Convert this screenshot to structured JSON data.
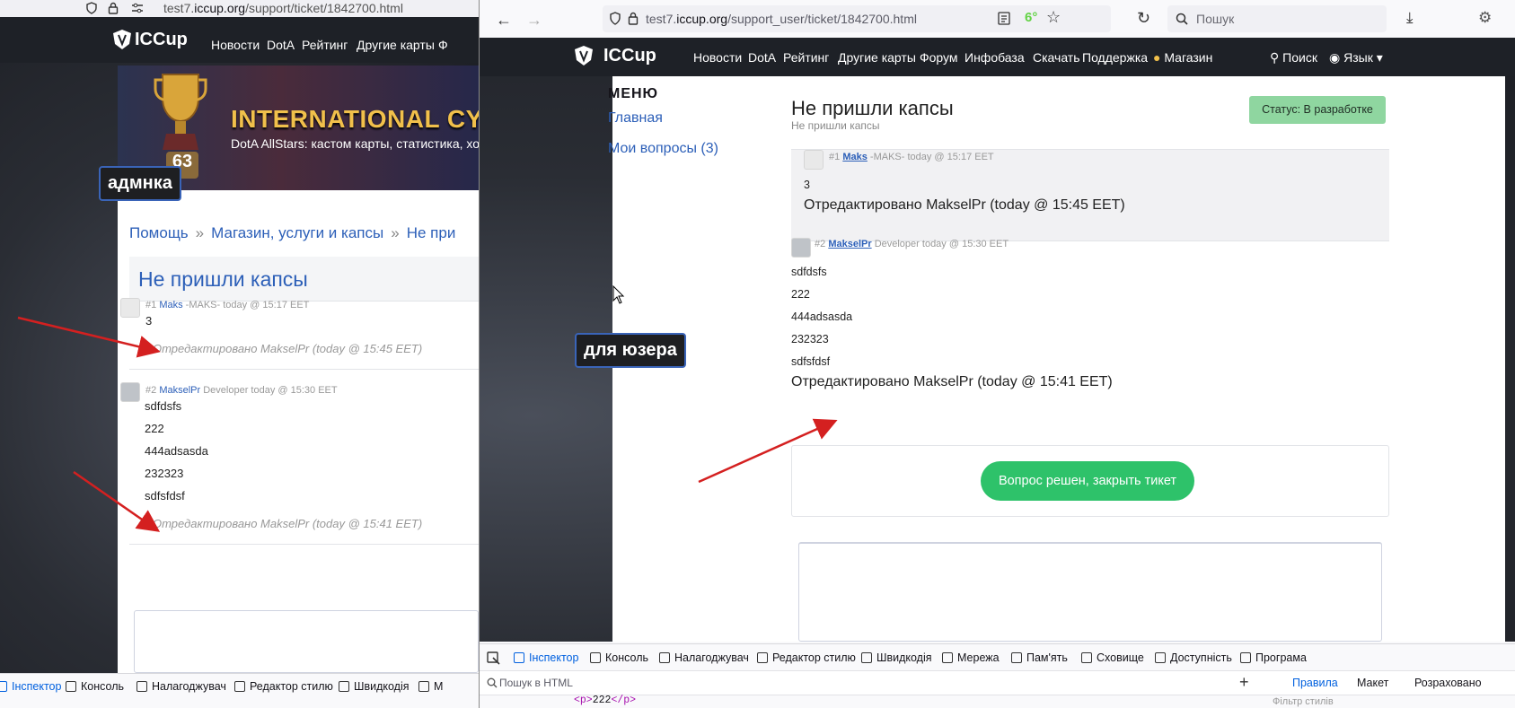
{
  "left_window": {
    "url_prefix": "test7.",
    "url_domain": "iccup.org",
    "url_path": "/support/ticket/1842700.html",
    "logo": "ICCup",
    "nav": [
      "Новости",
      "DotA",
      "Рейтинг",
      "Другие карты",
      "Ф"
    ],
    "banner": {
      "headline": "INTERNATIONAL CYBER C",
      "subline": "DotA AllStars: кастом карты, статистика, хост",
      "level": "63"
    },
    "annotation_label": "адмнка",
    "breadcrumb": [
      "Помощь",
      "Магазин, услуги и капсы",
      "Не при"
    ],
    "breadcrumb_sep": "»",
    "ticket_title": "Не пришли капсы",
    "posts": [
      {
        "num": "#1",
        "author": "Maks",
        "role": "-MAKS-",
        "time": "today @ 15:17 EET",
        "lines": [
          "3"
        ],
        "edited": "Отредактировано MakselPr (today @ 15:45 EET)"
      },
      {
        "num": "#2",
        "author": "MakselPr",
        "role": "Developer",
        "time": "today @ 15:30 EET",
        "lines": [
          "sdfdsfs",
          "222",
          "444adsasda",
          "232323",
          "sdfsfdsf"
        ],
        "edited": "Отредактировано MakselPr (today @ 15:41 EET)"
      }
    ],
    "devtools_tabs": [
      "Інспектор",
      "Консоль",
      "Налагоджувач",
      "Редактор стилю",
      "Швидкодія",
      "М"
    ]
  },
  "right_window": {
    "url_prefix": "test7.",
    "url_domain": "iccup.org",
    "url_path": "/support_user/ticket/1842700.html",
    "weather_badge": "6°",
    "search_placeholder": "Пошук",
    "logo": "ICCup",
    "nav": [
      "Новости",
      "DotA",
      "Рейтинг",
      "Другие карты",
      "Форум",
      "Инфобаза",
      "Скачать",
      "Поддержка",
      "Магазин"
    ],
    "nav_right": [
      "Поиск",
      "Язык"
    ],
    "menu_heading": "МЕНЮ",
    "menu_links": [
      "Главная",
      "Мои вопросы (3)"
    ],
    "annotation_label": "для юзера",
    "ticket_title": "Не пришли капсы",
    "ticket_subtitle": "Не пришли капсы",
    "status": "Статус: В разработке",
    "posts": [
      {
        "num": "#1",
        "author": "Maks",
        "role": "-MAKS-",
        "time": "today @ 15:17 EET",
        "lines": [
          "3"
        ],
        "edited": "Отредактировано MakselPr (today @ 15:45 EET)"
      },
      {
        "num": "#2",
        "author": "MakselPr",
        "role": "Developer",
        "time": "today @ 15:30 EET",
        "lines": [
          "sdfdsfs",
          "222",
          "444adsasda",
          "232323",
          "sdfsfdsf"
        ],
        "edited": "Отредактировано MakselPr (today @ 15:41 EET)"
      }
    ],
    "close_button": "Вопрос решен, закрыть тикет",
    "devtools_tabs": [
      "Інспектор",
      "Консоль",
      "Налагоджувач",
      "Редактор стилю",
      "Швидкодія",
      "Мережа",
      "Пам'ять",
      "Сховище",
      "Доступність",
      "Програма"
    ],
    "devtools_search": "Пошук в HTML",
    "devtools_right_tabs": [
      "Правила",
      "Макет",
      "Розраховано"
    ],
    "html_line_open": "<p>",
    "html_line_text": "222",
    "html_line_close": "</p>",
    "styles_filter": "Фільтр стилів"
  },
  "colors": {
    "link": "#2c5fb8",
    "status_bg": "#8fd6a0",
    "close_button_bg": "#2ec26a",
    "arrow": "#d42020",
    "nav_bg": "#1e2127"
  }
}
